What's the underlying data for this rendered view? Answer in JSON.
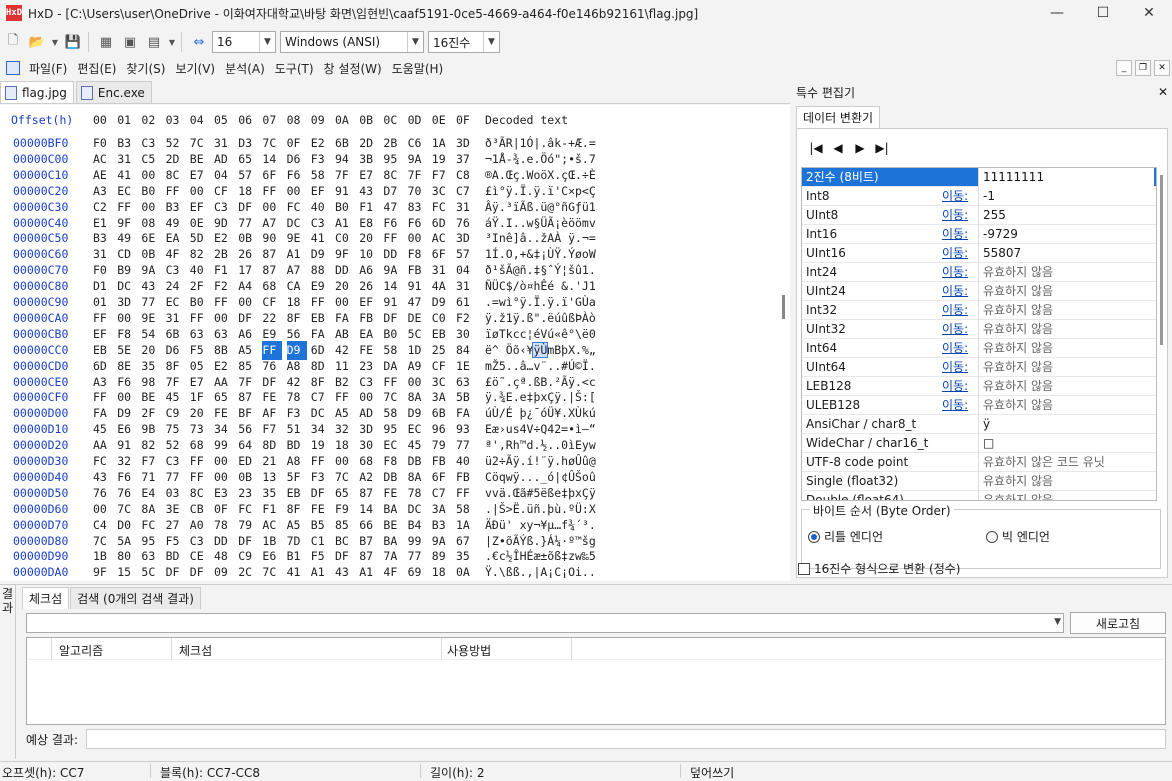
{
  "window": {
    "title": "HxD - [C:\\Users\\user\\OneDrive - 이화여자대학교\\바탕 화면\\임현빈\\caaf5191-0ce5-4669-a464-f0e146b92161\\flag.jpg]",
    "icon_text": "HxD"
  },
  "toolbar": {
    "bytes_per_row": "16",
    "charset": "Windows (ANSI)",
    "offset_base": "16진수"
  },
  "menu": [
    "파일(F)",
    "편집(E)",
    "찾기(S)",
    "보기(V)",
    "분석(A)",
    "도구(T)",
    "창 설정(W)",
    "도움말(H)"
  ],
  "tabs": [
    "flag.jpg",
    "Enc.exe"
  ],
  "hex": {
    "header_offset": "Offset(h)",
    "header_cols": [
      "00",
      "01",
      "02",
      "03",
      "04",
      "05",
      "06",
      "07",
      "08",
      "09",
      "0A",
      "0B",
      "0C",
      "0D",
      "0E",
      "0F"
    ],
    "header_decoded": "Decoded text",
    "rows": [
      {
        "offset": "00000BF0",
        "bytes": [
          "F0",
          "B3",
          "C3",
          "52",
          "7C",
          "31",
          "D3",
          "7C",
          "0F",
          "E2",
          "6B",
          "2D",
          "2B",
          "C6",
          "1A",
          "3D"
        ],
        "text": "ð³ÃR|1Ó|.âk-+Æ.="
      },
      {
        "offset": "00000C00",
        "bytes": [
          "AC",
          "31",
          "C5",
          "2D",
          "BE",
          "AD",
          "65",
          "14",
          "D6",
          "F3",
          "94",
          "3B",
          "95",
          "9A",
          "19",
          "37"
        ],
        "text": "¬1Å-¾.e.Öó\";•š.7"
      },
      {
        "offset": "00000C10",
        "bytes": [
          "AE",
          "41",
          "00",
          "8C",
          "E7",
          "04",
          "57",
          "6F",
          "F6",
          "58",
          "7F",
          "E7",
          "8C",
          "7F",
          "F7",
          "C8"
        ],
        "text": "®A.Œç.WoöX.çŒ.÷È"
      },
      {
        "offset": "00000C20",
        "bytes": [
          "A3",
          "EC",
          "B0",
          "FF",
          "00",
          "CF",
          "18",
          "FF",
          "00",
          "EF",
          "91",
          "43",
          "D7",
          "70",
          "3C",
          "C7"
        ],
        "text": "£ì°ÿ.Ï.ÿ.ï'C×p<Ç"
      },
      {
        "offset": "00000C30",
        "bytes": [
          "C2",
          "FF",
          "00",
          "B3",
          "EF",
          "C3",
          "DF",
          "00",
          "FC",
          "40",
          "B0",
          "F1",
          "47",
          "83",
          "FC",
          "31"
        ],
        "text": "Âÿ.³ïÃß.ü@°ñGƒü1"
      },
      {
        "offset": "00000C40",
        "bytes": [
          "E1",
          "9F",
          "08",
          "49",
          "0E",
          "9D",
          "77",
          "A7",
          "DC",
          "C3",
          "A1",
          "E8",
          "F6",
          "F6",
          "6D",
          "76"
        ],
        "text": "áŸ.I..w§ÜÃ¡èöömv"
      },
      {
        "offset": "00000C50",
        "bytes": [
          "B3",
          "49",
          "6E",
          "EA",
          "5D",
          "E2",
          "0B",
          "90",
          "9E",
          "41",
          "C0",
          "20",
          "FF",
          "00",
          "AC",
          "3D"
        ],
        "text": "³Inê]â..žAÀ ÿ.¬="
      },
      {
        "offset": "00000C60",
        "bytes": [
          "31",
          "CD",
          "0B",
          "4F",
          "82",
          "2B",
          "26",
          "87",
          "A1",
          "D9",
          "9F",
          "10",
          "DD",
          "F8",
          "6F",
          "57"
        ],
        "text": "1Í.O‚+&‡¡ÙŸ.ÝøoW"
      },
      {
        "offset": "00000C70",
        "bytes": [
          "F0",
          "B9",
          "9A",
          "C3",
          "40",
          "F1",
          "17",
          "87",
          "A7",
          "88",
          "DD",
          "A6",
          "9A",
          "FB",
          "31",
          "04"
        ],
        "text": "ð¹šÃ@ñ.‡§ˆÝ¦šû1."
      },
      {
        "offset": "00000C80",
        "bytes": [
          "D1",
          "DC",
          "43",
          "24",
          "2F",
          "F2",
          "A4",
          "68",
          "CA",
          "E9",
          "20",
          "26",
          "14",
          "91",
          "4A",
          "31"
        ],
        "text": "ÑÜC$/ò¤hÊé &.'J1"
      },
      {
        "offset": "00000C90",
        "bytes": [
          "01",
          "3D",
          "77",
          "EC",
          "B0",
          "FF",
          "00",
          "CF",
          "18",
          "FF",
          "00",
          "EF",
          "91",
          "47",
          "D9",
          "61"
        ],
        "text": ".=wì°ÿ.Ï.ÿ.ï'GÙa"
      },
      {
        "offset": "00000CA0",
        "bytes": [
          "FF",
          "00",
          "9E",
          "31",
          "FF",
          "00",
          "DF",
          "22",
          "8F",
          "EB",
          "FA",
          "FB",
          "DF",
          "DE",
          "C0",
          "F2"
        ],
        "text": "ÿ.ž1ÿ.ß\".ëúûßÞÀò"
      },
      {
        "offset": "00000CB0",
        "bytes": [
          "EF",
          "F8",
          "54",
          "6B",
          "63",
          "63",
          "A6",
          "E9",
          "56",
          "FA",
          "AB",
          "EA",
          "B0",
          "5C",
          "EB",
          "30"
        ],
        "text": "ïøTkcc¦éVú«ê°\\ë0"
      },
      {
        "offset": "00000CC0",
        "bytes": [
          "EB",
          "5E",
          "20",
          "D6",
          "F5",
          "8B",
          "A5",
          "FF",
          "D9",
          "6D",
          "42",
          "FE",
          "58",
          "1D",
          "25",
          "84"
        ],
        "text": "ë^ Öõ‹¥ÿÙmBþX.%„"
      },
      {
        "offset": "00000CD0",
        "bytes": [
          "6D",
          "8E",
          "35",
          "8F",
          "05",
          "E2",
          "85",
          "76",
          "A8",
          "8D",
          "11",
          "23",
          "DA",
          "A9",
          "CF",
          "1E"
        ],
        "text": "mŽ5..â…v¨..#Ú©Ï."
      },
      {
        "offset": "00000CE0",
        "bytes": [
          "A3",
          "F6",
          "98",
          "7F",
          "E7",
          "AA",
          "7F",
          "DF",
          "42",
          "8F",
          "B2",
          "C3",
          "FF",
          "00",
          "3C",
          "63"
        ],
        "text": "£ö˜.çª.ßB.²Ãÿ.<c"
      },
      {
        "offset": "00000CF0",
        "bytes": [
          "FF",
          "00",
          "BE",
          "45",
          "1F",
          "65",
          "87",
          "FE",
          "78",
          "C7",
          "FF",
          "00",
          "7C",
          "8A",
          "3A",
          "5B"
        ],
        "text": "ÿ.¾E.e‡þxÇÿ.|Š:["
      },
      {
        "offset": "00000D00",
        "bytes": [
          "FA",
          "D9",
          "2F",
          "C9",
          "20",
          "FE",
          "BF",
          "AF",
          "F3",
          "DC",
          "A5",
          "AD",
          "58",
          "D9",
          "6B",
          "FA"
        ],
        "text": "úÙ/É þ¿¯óÜ¥.XÙkú"
      },
      {
        "offset": "00000D10",
        "bytes": [
          "45",
          "E6",
          "9B",
          "75",
          "73",
          "34",
          "56",
          "F7",
          "51",
          "34",
          "32",
          "3D",
          "95",
          "EC",
          "96",
          "93"
        ],
        "text": "Eæ›us4V÷Q42=•ì–“"
      },
      {
        "offset": "00000D20",
        "bytes": [
          "AA",
          "91",
          "82",
          "52",
          "68",
          "99",
          "64",
          "8D",
          "BD",
          "19",
          "18",
          "30",
          "EC",
          "45",
          "79",
          "77"
        ],
        "text": "ª'‚Rh™d.½..0ìEyw"
      },
      {
        "offset": "00000D30",
        "bytes": [
          "FC",
          "32",
          "F7",
          "C3",
          "FF",
          "00",
          "ED",
          "21",
          "A8",
          "FF",
          "00",
          "68",
          "F8",
          "DB",
          "FB",
          "40"
        ],
        "text": "ü2÷Ãÿ.í!¨ÿ.høÛû@"
      },
      {
        "offset": "00000D40",
        "bytes": [
          "43",
          "F6",
          "71",
          "77",
          "FF",
          "00",
          "0B",
          "13",
          "5F",
          "F3",
          "7C",
          "A2",
          "DB",
          "8A",
          "6F",
          "FB"
        ],
        "text": "Cöqwÿ..._ó|¢ÛŠoû"
      },
      {
        "offset": "00000D50",
        "bytes": [
          "76",
          "76",
          "E4",
          "03",
          "8C",
          "E3",
          "23",
          "35",
          "EB",
          "DF",
          "65",
          "87",
          "FE",
          "78",
          "C7",
          "FF"
        ],
        "text": "vvä.Œã#5ëße‡þxÇÿ"
      },
      {
        "offset": "00000D60",
        "bytes": [
          "00",
          "7C",
          "8A",
          "3E",
          "CB",
          "0F",
          "FC",
          "F1",
          "8F",
          "FE",
          "F9",
          "14",
          "BA",
          "DC",
          "3A",
          "58"
        ],
        "text": ".|Š>Ë.üñ.þù.ºÜ:X"
      },
      {
        "offset": "00000D70",
        "bytes": [
          "C4",
          "D0",
          "FC",
          "27",
          "A0",
          "78",
          "79",
          "AC",
          "A5",
          "B5",
          "85",
          "66",
          "BE",
          "B4",
          "B3",
          "1A"
        ],
        "text": "ÄÐü' xy¬¥µ…f¾´³."
      },
      {
        "offset": "00000D80",
        "bytes": [
          "7C",
          "5A",
          "95",
          "F5",
          "C3",
          "DD",
          "DF",
          "1B",
          "7D",
          "C1",
          "BC",
          "B7",
          "BA",
          "99",
          "9A",
          "67"
        ],
        "text": "|Z•õÃÝß.}Á¼·º™šg"
      },
      {
        "offset": "00000D90",
        "bytes": [
          "1B",
          "80",
          "63",
          "BD",
          "CE",
          "48",
          "C9",
          "E6",
          "B1",
          "F5",
          "DF",
          "87",
          "7A",
          "77",
          "89",
          "35"
        ],
        "text": ".€c½ÎHÉæ±õß‡zw‰5"
      },
      {
        "offset": "00000DA0",
        "bytes": [
          "9F",
          "15",
          "5C",
          "DF",
          "DF",
          "09",
          "2C",
          "7C",
          "41",
          "A1",
          "43",
          "A1",
          "4F",
          "69",
          "18",
          "0A"
        ],
        "text": "Ÿ.\\ßß.,|A¡C¡Oi.."
      }
    ]
  },
  "inspector": {
    "title": "특수 편집기",
    "tab": "데이터 변환기",
    "goto_label": "이동:",
    "rows": [
      {
        "name": "2진수 (8비트)",
        "value": "11111111",
        "link": false,
        "invalid": false
      },
      {
        "name": "Int8",
        "value": "-1",
        "link": true,
        "invalid": false
      },
      {
        "name": "UInt8",
        "value": "255",
        "link": true,
        "invalid": false
      },
      {
        "name": "Int16",
        "value": "-9729",
        "link": true,
        "invalid": false
      },
      {
        "name": "UInt16",
        "value": "55807",
        "link": true,
        "invalid": false
      },
      {
        "name": "Int24",
        "value": "유효하지 않음",
        "link": true,
        "invalid": true
      },
      {
        "name": "UInt24",
        "value": "유효하지 않음",
        "link": true,
        "invalid": true
      },
      {
        "name": "Int32",
        "value": "유효하지 않음",
        "link": true,
        "invalid": true
      },
      {
        "name": "UInt32",
        "value": "유효하지 않음",
        "link": true,
        "invalid": true
      },
      {
        "name": "Int64",
        "value": "유효하지 않음",
        "link": true,
        "invalid": true
      },
      {
        "name": "UInt64",
        "value": "유효하지 않음",
        "link": true,
        "invalid": true
      },
      {
        "name": "LEB128",
        "value": "유효하지 않음",
        "link": true,
        "invalid": true
      },
      {
        "name": "ULEB128",
        "value": "유효하지 않음",
        "link": true,
        "invalid": true
      },
      {
        "name": "AnsiChar / char8_t",
        "value": "ÿ",
        "link": false,
        "invalid": false
      },
      {
        "name": "WideChar / char16_t",
        "value": "□",
        "link": false,
        "invalid": false
      },
      {
        "name": "UTF-8 code point",
        "value": "유효하지 않은 코드 유닛",
        "link": false,
        "invalid": true
      },
      {
        "name": "Single (float32)",
        "value": "유효하지 않음",
        "link": false,
        "invalid": true
      },
      {
        "name": "Double (float64)",
        "value": "유효하지 않음",
        "link": false,
        "invalid": true
      }
    ],
    "byte_order_title": "바이트 순서 (Byte Order)",
    "little_endian": "리틀 엔디언",
    "big_endian": "빅 엔디언",
    "hex_int_checkbox": "16진수 형식으로 변환 (정수)"
  },
  "results": {
    "side_label": "결과",
    "tab_checksum": "체크섬",
    "tab_search": "검색 (0개의 검색 결과)",
    "refresh": "새로고침",
    "col_algorithm": "알고리즘",
    "col_checksum": "체크섬",
    "col_usage": "사용방법",
    "expected_label": "예상 결과:"
  },
  "status": {
    "offset": "오프셋(h): CC7",
    "block": "블록(h): CC7-CC8",
    "length": "길이(h): 2",
    "mode": "덮어쓰기"
  },
  "selection": {
    "row": 13,
    "cols": [
      7,
      8
    ],
    "text_start": 7,
    "text_len": 2
  },
  "colors": {
    "accent": "#1e73d8",
    "offset_blue": "#1a3fc4",
    "link": "#0645ad"
  }
}
